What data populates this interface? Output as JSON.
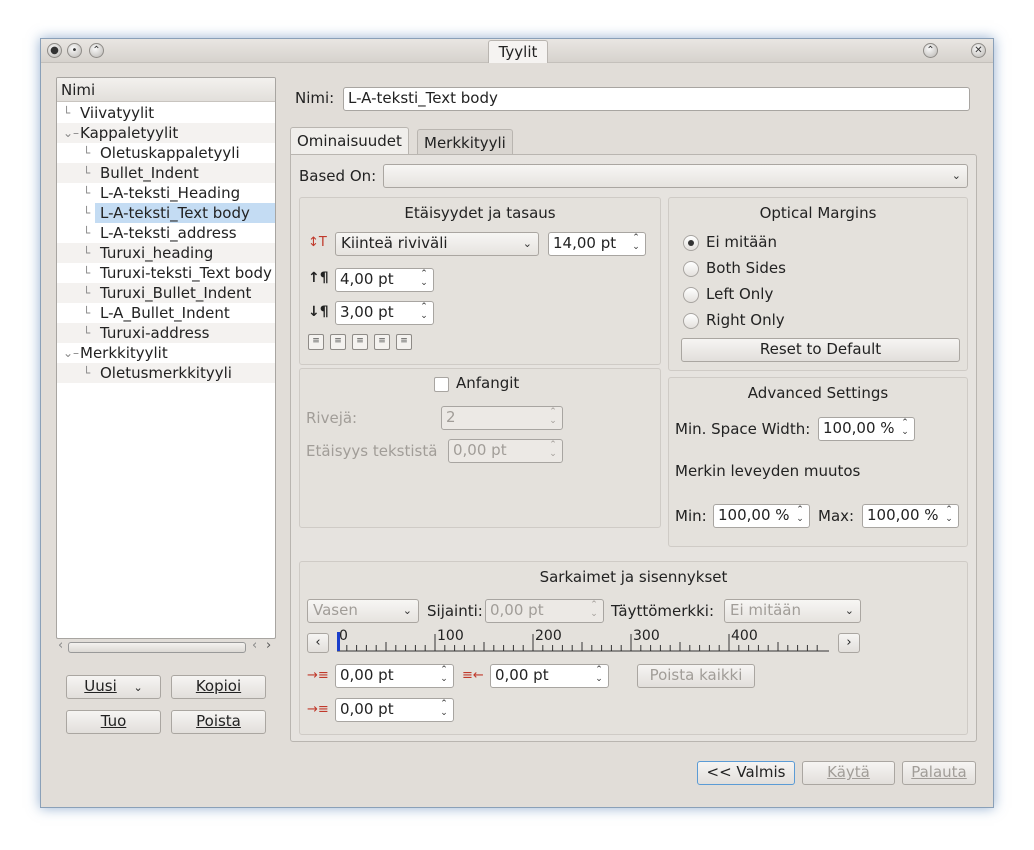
{
  "window": {
    "title": "Tyylit"
  },
  "tree": {
    "header": "Nimi",
    "items": [
      {
        "label": "Viivatyylit",
        "level": 0,
        "expander": ""
      },
      {
        "label": "Kappaletyylit",
        "level": 0,
        "expander": "⌄"
      },
      {
        "label": "Oletuskappaletyyli",
        "level": 1,
        "expander": ""
      },
      {
        "label": "Bullet_Indent",
        "level": 1,
        "expander": ""
      },
      {
        "label": "L-A-teksti_Heading",
        "level": 1,
        "expander": ""
      },
      {
        "label": "L-A-teksti_Text body",
        "level": 1,
        "expander": "",
        "selected": true
      },
      {
        "label": "L-A-teksti_address",
        "level": 1,
        "expander": ""
      },
      {
        "label": "Turuxi_heading",
        "level": 1,
        "expander": ""
      },
      {
        "label": "Turuxi-teksti_Text body",
        "level": 1,
        "expander": ""
      },
      {
        "label": "Turuxi_Bullet_Indent",
        "level": 1,
        "expander": ""
      },
      {
        "label": "L-A_Bullet_Indent",
        "level": 1,
        "expander": ""
      },
      {
        "label": "Turuxi-address",
        "level": 1,
        "expander": ""
      },
      {
        "label": "Merkkityylit",
        "level": 0,
        "expander": "⌄"
      },
      {
        "label": "Oletusmerkkityyli",
        "level": 1,
        "expander": ""
      }
    ]
  },
  "left_buttons": {
    "new": "Uusi",
    "copy": "Kopioi",
    "import": "Tuo",
    "delete": "Poista"
  },
  "name_field": {
    "label": "Nimi:",
    "value": "L-A-teksti_Text body"
  },
  "tabs": [
    {
      "label": "Ominaisuudet"
    },
    {
      "label": "Merkkityyli"
    }
  ],
  "based_on": {
    "label": "Based On:",
    "value": ""
  },
  "spacing": {
    "title": "Etäisyydet ja tasaus",
    "line_spacing_mode": "Kiinteä riviväli",
    "line_spacing_value": "14,00 pt",
    "space_above": "4,00 pt",
    "space_below": "3,00 pt"
  },
  "optical": {
    "title": "Optical Margins",
    "options": [
      "Ei mitään",
      "Both Sides",
      "Left Only",
      "Right Only"
    ],
    "selected": "Ei mitään",
    "reset": "Reset to Default"
  },
  "dropcaps": {
    "label": "Anfangit",
    "rows_label": "Rivejä:",
    "rows_value": "2",
    "distance_label": "Etäisyys tekstistä",
    "distance_value": "0,00 pt"
  },
  "advanced": {
    "title": "Advanced Settings",
    "min_space_label": "Min. Space Width:",
    "min_space_value": "100,00 %",
    "glyph_label": "Merkin leveyden muutos",
    "min_label": "Min:",
    "min_value": "100,00 %",
    "max_label": "Max:",
    "max_value": "100,00 %"
  },
  "tabs_section": {
    "title": "Sarkaimet ja sisennykset",
    "align_value": "Vasen",
    "position_label": "Sijainti:",
    "position_value": "0,00 pt",
    "fill_label": "Täyttömerkki:",
    "fill_value": "Ei mitään",
    "ruler_labels": [
      "0",
      "100",
      "200",
      "300",
      "400"
    ],
    "first_indent": "0,00 pt",
    "right_indent": "0,00 pt",
    "left_indent": "0,00 pt",
    "delete_all": "Poista kaikki"
  },
  "bottom_buttons": {
    "done": "<< Valmis",
    "apply": "Käytä",
    "revert": "Palauta"
  }
}
